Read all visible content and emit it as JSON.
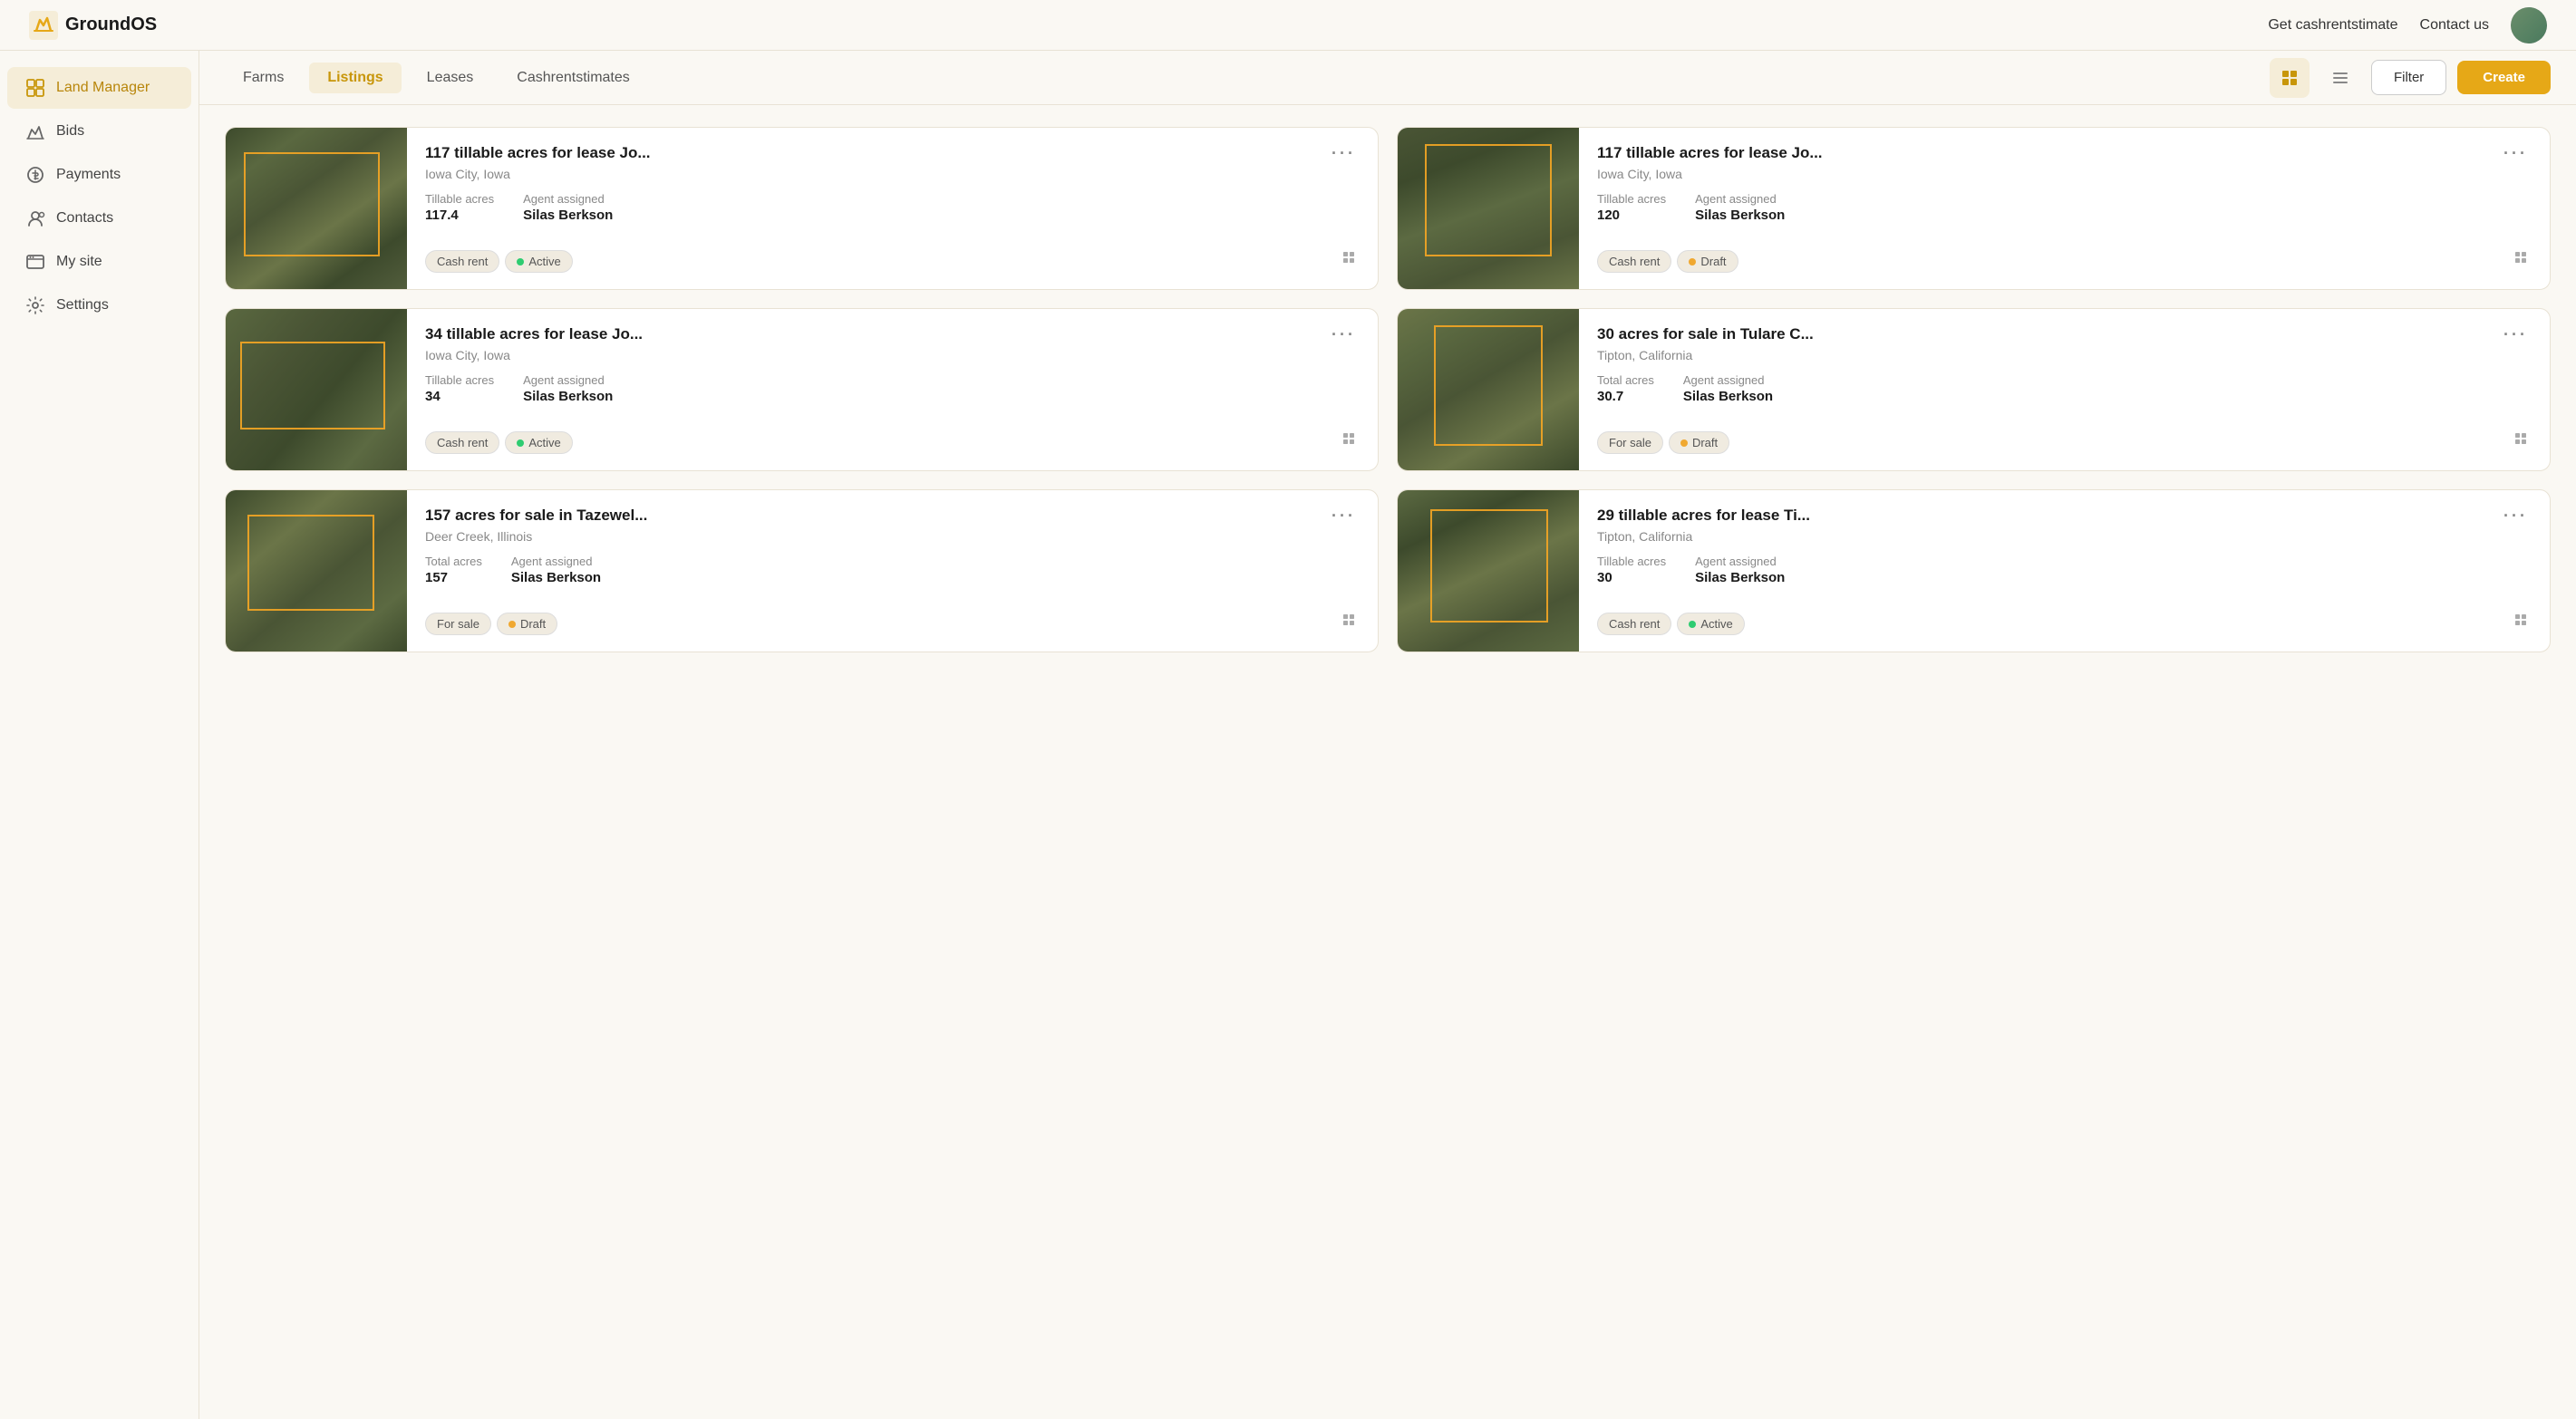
{
  "app": {
    "name": "GroundOS"
  },
  "topnav": {
    "cashrentstimate_label": "Get cashrentstimate",
    "contact_label": "Contact us"
  },
  "sidebar": {
    "items": [
      {
        "id": "land-manager",
        "label": "Land Manager",
        "active": true
      },
      {
        "id": "bids",
        "label": "Bids",
        "active": false
      },
      {
        "id": "payments",
        "label": "Payments",
        "active": false
      },
      {
        "id": "contacts",
        "label": "Contacts",
        "active": false
      },
      {
        "id": "my-site",
        "label": "My site",
        "active": false
      },
      {
        "id": "settings",
        "label": "Settings",
        "active": false
      }
    ]
  },
  "secondarynav": {
    "tabs": [
      {
        "id": "farms",
        "label": "Farms",
        "active": false
      },
      {
        "id": "listings",
        "label": "Listings",
        "active": true
      },
      {
        "id": "leases",
        "label": "Leases",
        "active": false
      },
      {
        "id": "cashrentstimates",
        "label": "Cashrentstimates",
        "active": false
      }
    ],
    "filter_label": "Filter",
    "create_label": "Create"
  },
  "listings": [
    {
      "id": 1,
      "title": "117 tillable acres for lease Jo...",
      "location": "Iowa City, Iowa",
      "acres_label": "Tillable acres",
      "acres_value": "117.4",
      "agent_label": "Agent assigned",
      "agent_value": "Silas Berkson",
      "type_tag": "Cash rent",
      "status_tag": "Active",
      "status_type": "active",
      "sat_class": "sat1"
    },
    {
      "id": 2,
      "title": "117 tillable acres for lease Jo...",
      "location": "Iowa City, Iowa",
      "acres_label": "Tillable acres",
      "acres_value": "120",
      "agent_label": "Agent assigned",
      "agent_value": "Silas Berkson",
      "type_tag": "Cash rent",
      "status_tag": "Draft",
      "status_type": "draft",
      "sat_class": "sat2"
    },
    {
      "id": 3,
      "title": "34 tillable acres for lease Jo...",
      "location": "Iowa City, Iowa",
      "acres_label": "Tillable acres",
      "acres_value": "34",
      "agent_label": "Agent assigned",
      "agent_value": "Silas Berkson",
      "type_tag": "Cash rent",
      "status_tag": "Active",
      "status_type": "active",
      "sat_class": "sat3"
    },
    {
      "id": 4,
      "title": "30 acres for sale in Tulare C...",
      "location": "Tipton, California",
      "acres_label": "Total acres",
      "acres_value": "30.7",
      "agent_label": "Agent assigned",
      "agent_value": "Silas Berkson",
      "type_tag": "For sale",
      "status_tag": "Draft",
      "status_type": "draft",
      "sat_class": "sat4"
    },
    {
      "id": 5,
      "title": "157 acres for sale in Tazewel...",
      "location": "Deer Creek, Illinois",
      "acres_label": "Total acres",
      "acres_value": "157",
      "agent_label": "Agent assigned",
      "agent_value": "Silas Berkson",
      "type_tag": "For sale",
      "status_tag": "Draft",
      "status_type": "draft",
      "sat_class": "sat5"
    },
    {
      "id": 6,
      "title": "29 tillable acres for lease Ti...",
      "location": "Tipton, California",
      "acres_label": "Tillable acres",
      "acres_value": "30",
      "agent_label": "Agent assigned",
      "agent_value": "Silas Berkson",
      "type_tag": "Cash rent",
      "status_tag": "Active",
      "status_type": "active",
      "sat_class": "sat6"
    }
  ]
}
